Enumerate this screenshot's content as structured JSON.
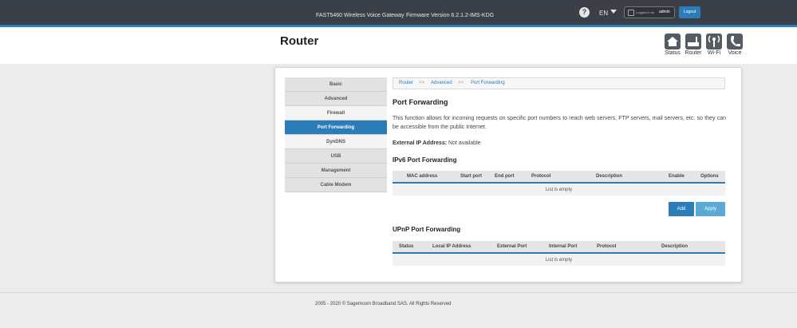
{
  "topbar": {
    "model": "FAST5460 Wireless Voice Gateway",
    "firmware": "Firmware Version 6.2.1.2-IMS-KDG",
    "help": "?",
    "language": "EN",
    "logged_in_label": "Logged in as",
    "username": "admin",
    "logout": "Logout"
  },
  "header": {
    "title": "Router",
    "nav": [
      {
        "label": "Status",
        "icon": "home-icon"
      },
      {
        "label": "Router",
        "icon": "router-icon"
      },
      {
        "label": "Wi-Fi",
        "icon": "wifi-icon"
      },
      {
        "label": "Voice",
        "icon": "phone-icon"
      }
    ]
  },
  "sidebar": {
    "items": [
      {
        "label": "Basic"
      },
      {
        "label": "Advanced"
      },
      {
        "label": "Firewall"
      },
      {
        "label": "Port Forwarding"
      },
      {
        "label": "DynDNS"
      },
      {
        "label": "USB"
      },
      {
        "label": "Management"
      },
      {
        "label": "Cable Modem"
      }
    ]
  },
  "breadcrumb": {
    "items": [
      "Router",
      "Advanced",
      "Port Forwarding"
    ],
    "separator": ">>"
  },
  "content": {
    "title": "Port Forwarding",
    "description": "This function allows for incoming requests on specific port numbers to reach web servers, FTP servers, mail servers, etc. so they can be accessible from the public Internet.",
    "external_ip_label": "External IP Address:",
    "external_ip_value": "Not available",
    "ipv6": {
      "title": "IPv6 Port Forwarding",
      "columns": [
        "MAC address",
        "Start port",
        "End port",
        "Protocol",
        "Description",
        "Enable",
        "Options"
      ],
      "empty": "List is empty"
    },
    "buttons": {
      "add": "Add",
      "apply": "Apply"
    },
    "upnp": {
      "title": "UPnP Port Forwarding",
      "columns": [
        "Status",
        "Local IP Address",
        "External Port",
        "Internal Port",
        "Protocol",
        "Description"
      ],
      "empty": "List is empty"
    }
  },
  "footer": {
    "copyright": "2005 - 2020 © Sagemcom Broadband SAS. All Rights Reserved"
  },
  "colors": {
    "topbar": "#3b4048",
    "accent": "#2a7db8",
    "apply": "#5aaad8"
  }
}
